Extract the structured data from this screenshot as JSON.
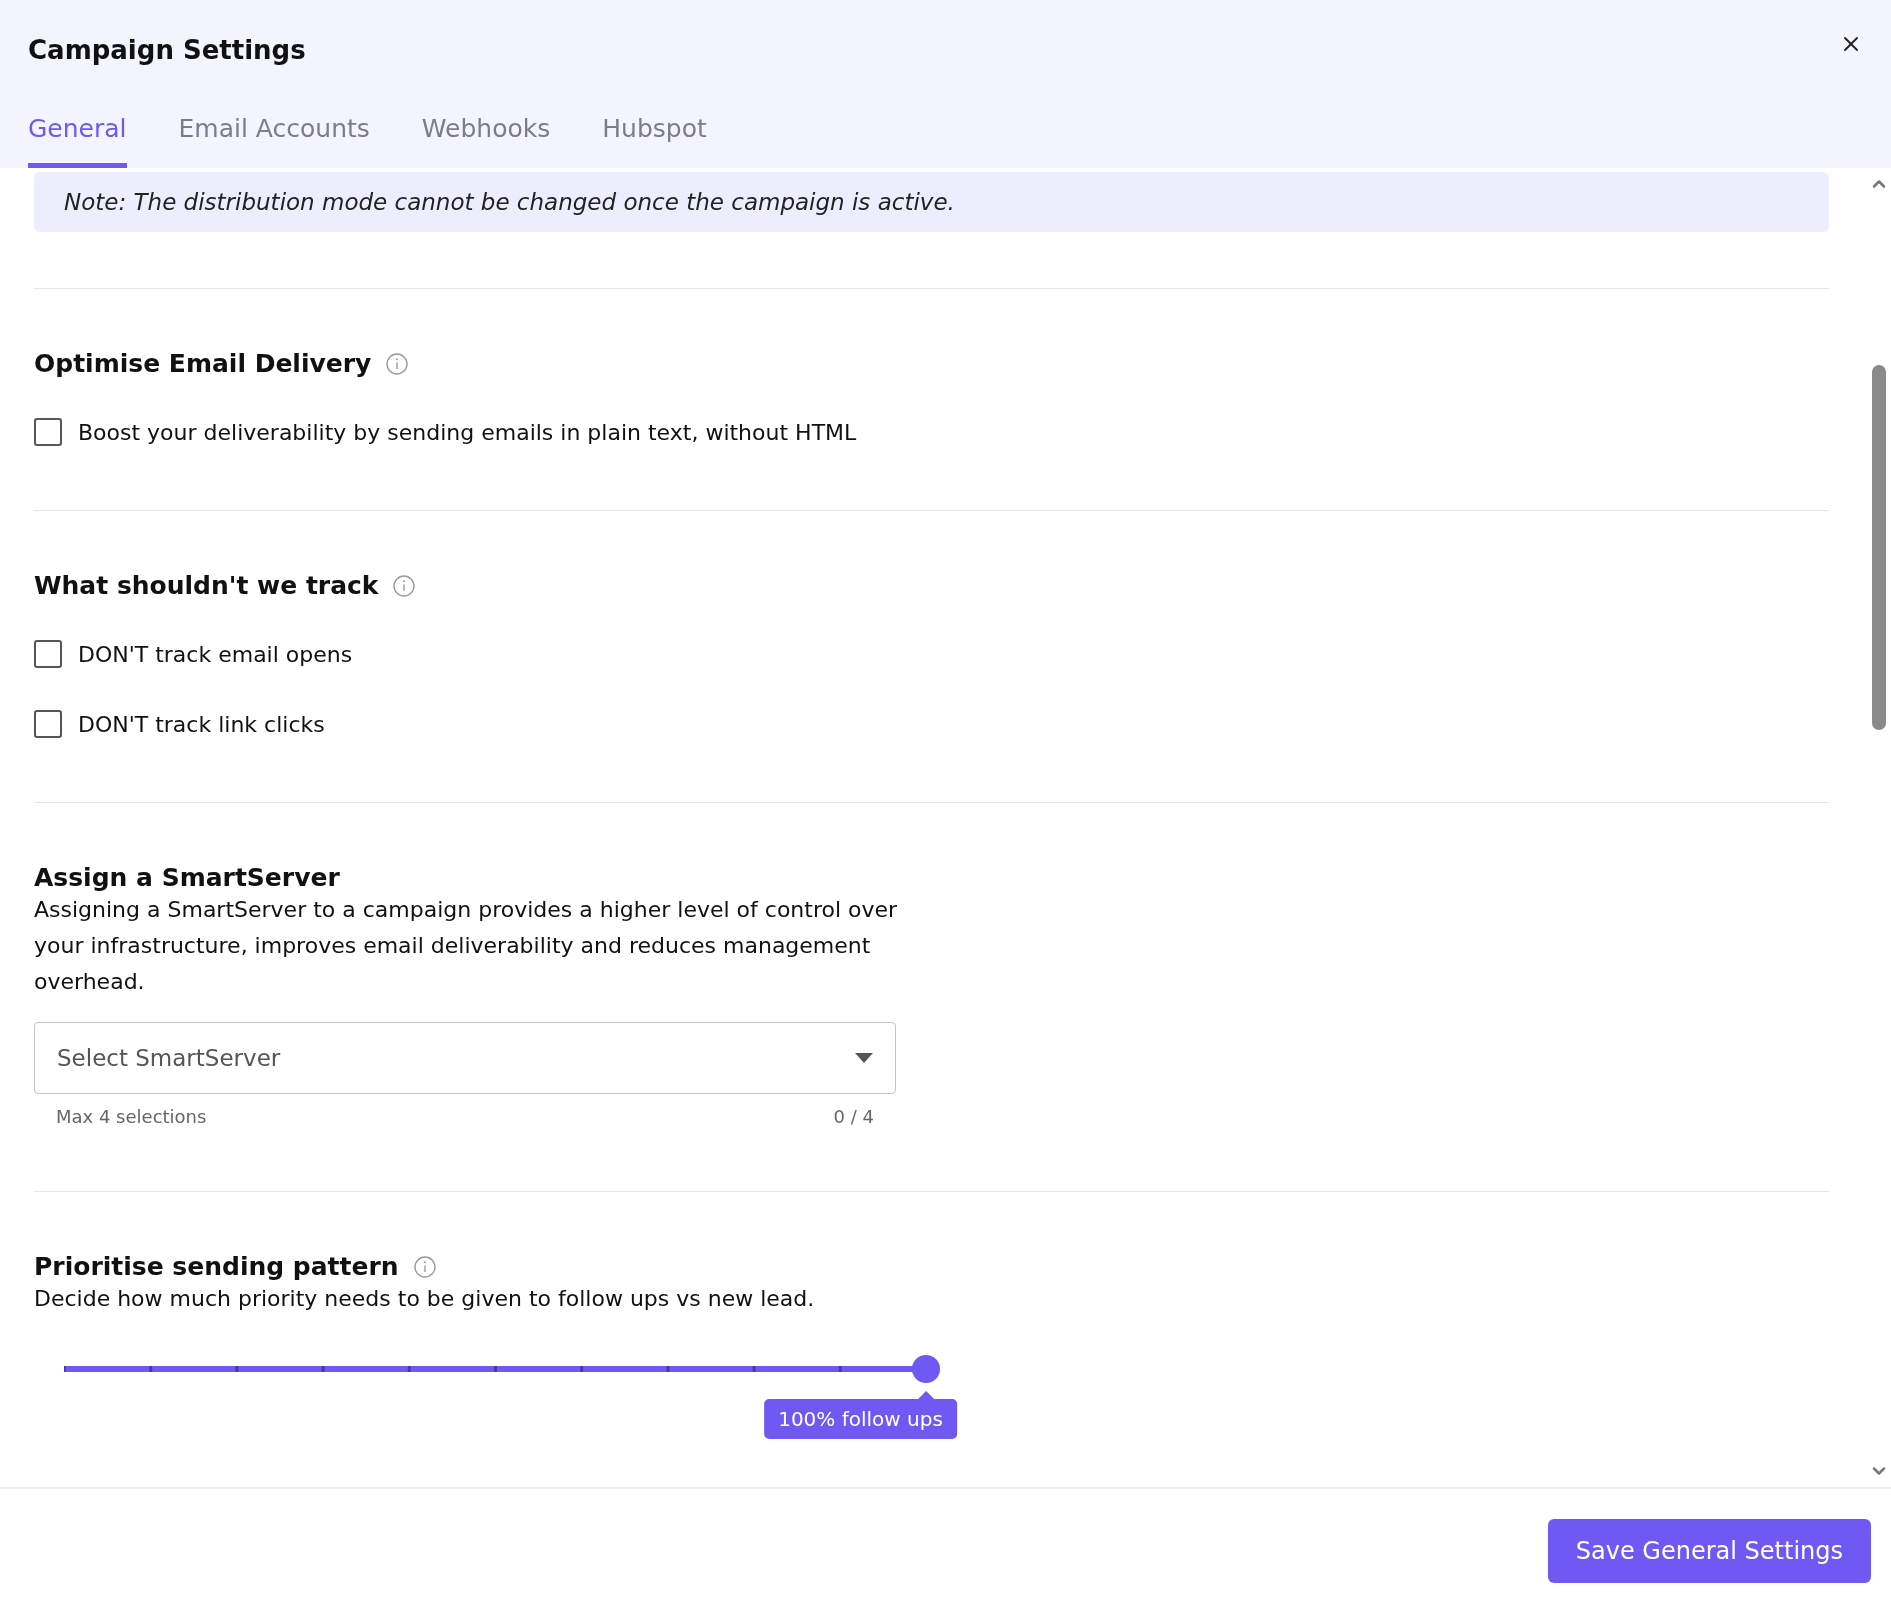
{
  "window": {
    "title": "Campaign Settings"
  },
  "tabs": [
    {
      "label": "General",
      "selected": true
    },
    {
      "label": "Email Accounts",
      "selected": false
    },
    {
      "label": "Webhooks",
      "selected": false
    },
    {
      "label": "Hubspot",
      "selected": false
    }
  ],
  "note": "Note: The distribution mode cannot be changed once the campaign is active.",
  "sections": [
    {
      "kind": "checkboxes",
      "heading": "Optimise Email Delivery",
      "info": true,
      "options": [
        {
          "label": "Boost your deliverability by sending emails in plain text, without HTML",
          "checked": false
        }
      ]
    },
    {
      "kind": "checkboxes",
      "heading": "What shouldn't we track",
      "info": true,
      "options": [
        {
          "label": "DON'T track email opens",
          "checked": false
        },
        {
          "label": "DON'T track link clicks",
          "checked": false
        }
      ]
    },
    {
      "kind": "select",
      "heading": "Assign a SmartServer",
      "info": false,
      "description": "Assigning a SmartServer to a campaign provides a higher level of control over your infrastructure, improves email deliverability and reduces management overhead.",
      "placeholder": "Select SmartServer",
      "hint": "Max 4 selections",
      "counter": "0 / 4"
    },
    {
      "kind": "slider",
      "heading": "Prioritise sending pattern",
      "info": true,
      "description": "Decide how much priority needs to be given to follow ups vs new lead.",
      "level": 1,
      "value_label": "100% follow ups"
    }
  ],
  "footer": {
    "button": "Save General Settings"
  }
}
